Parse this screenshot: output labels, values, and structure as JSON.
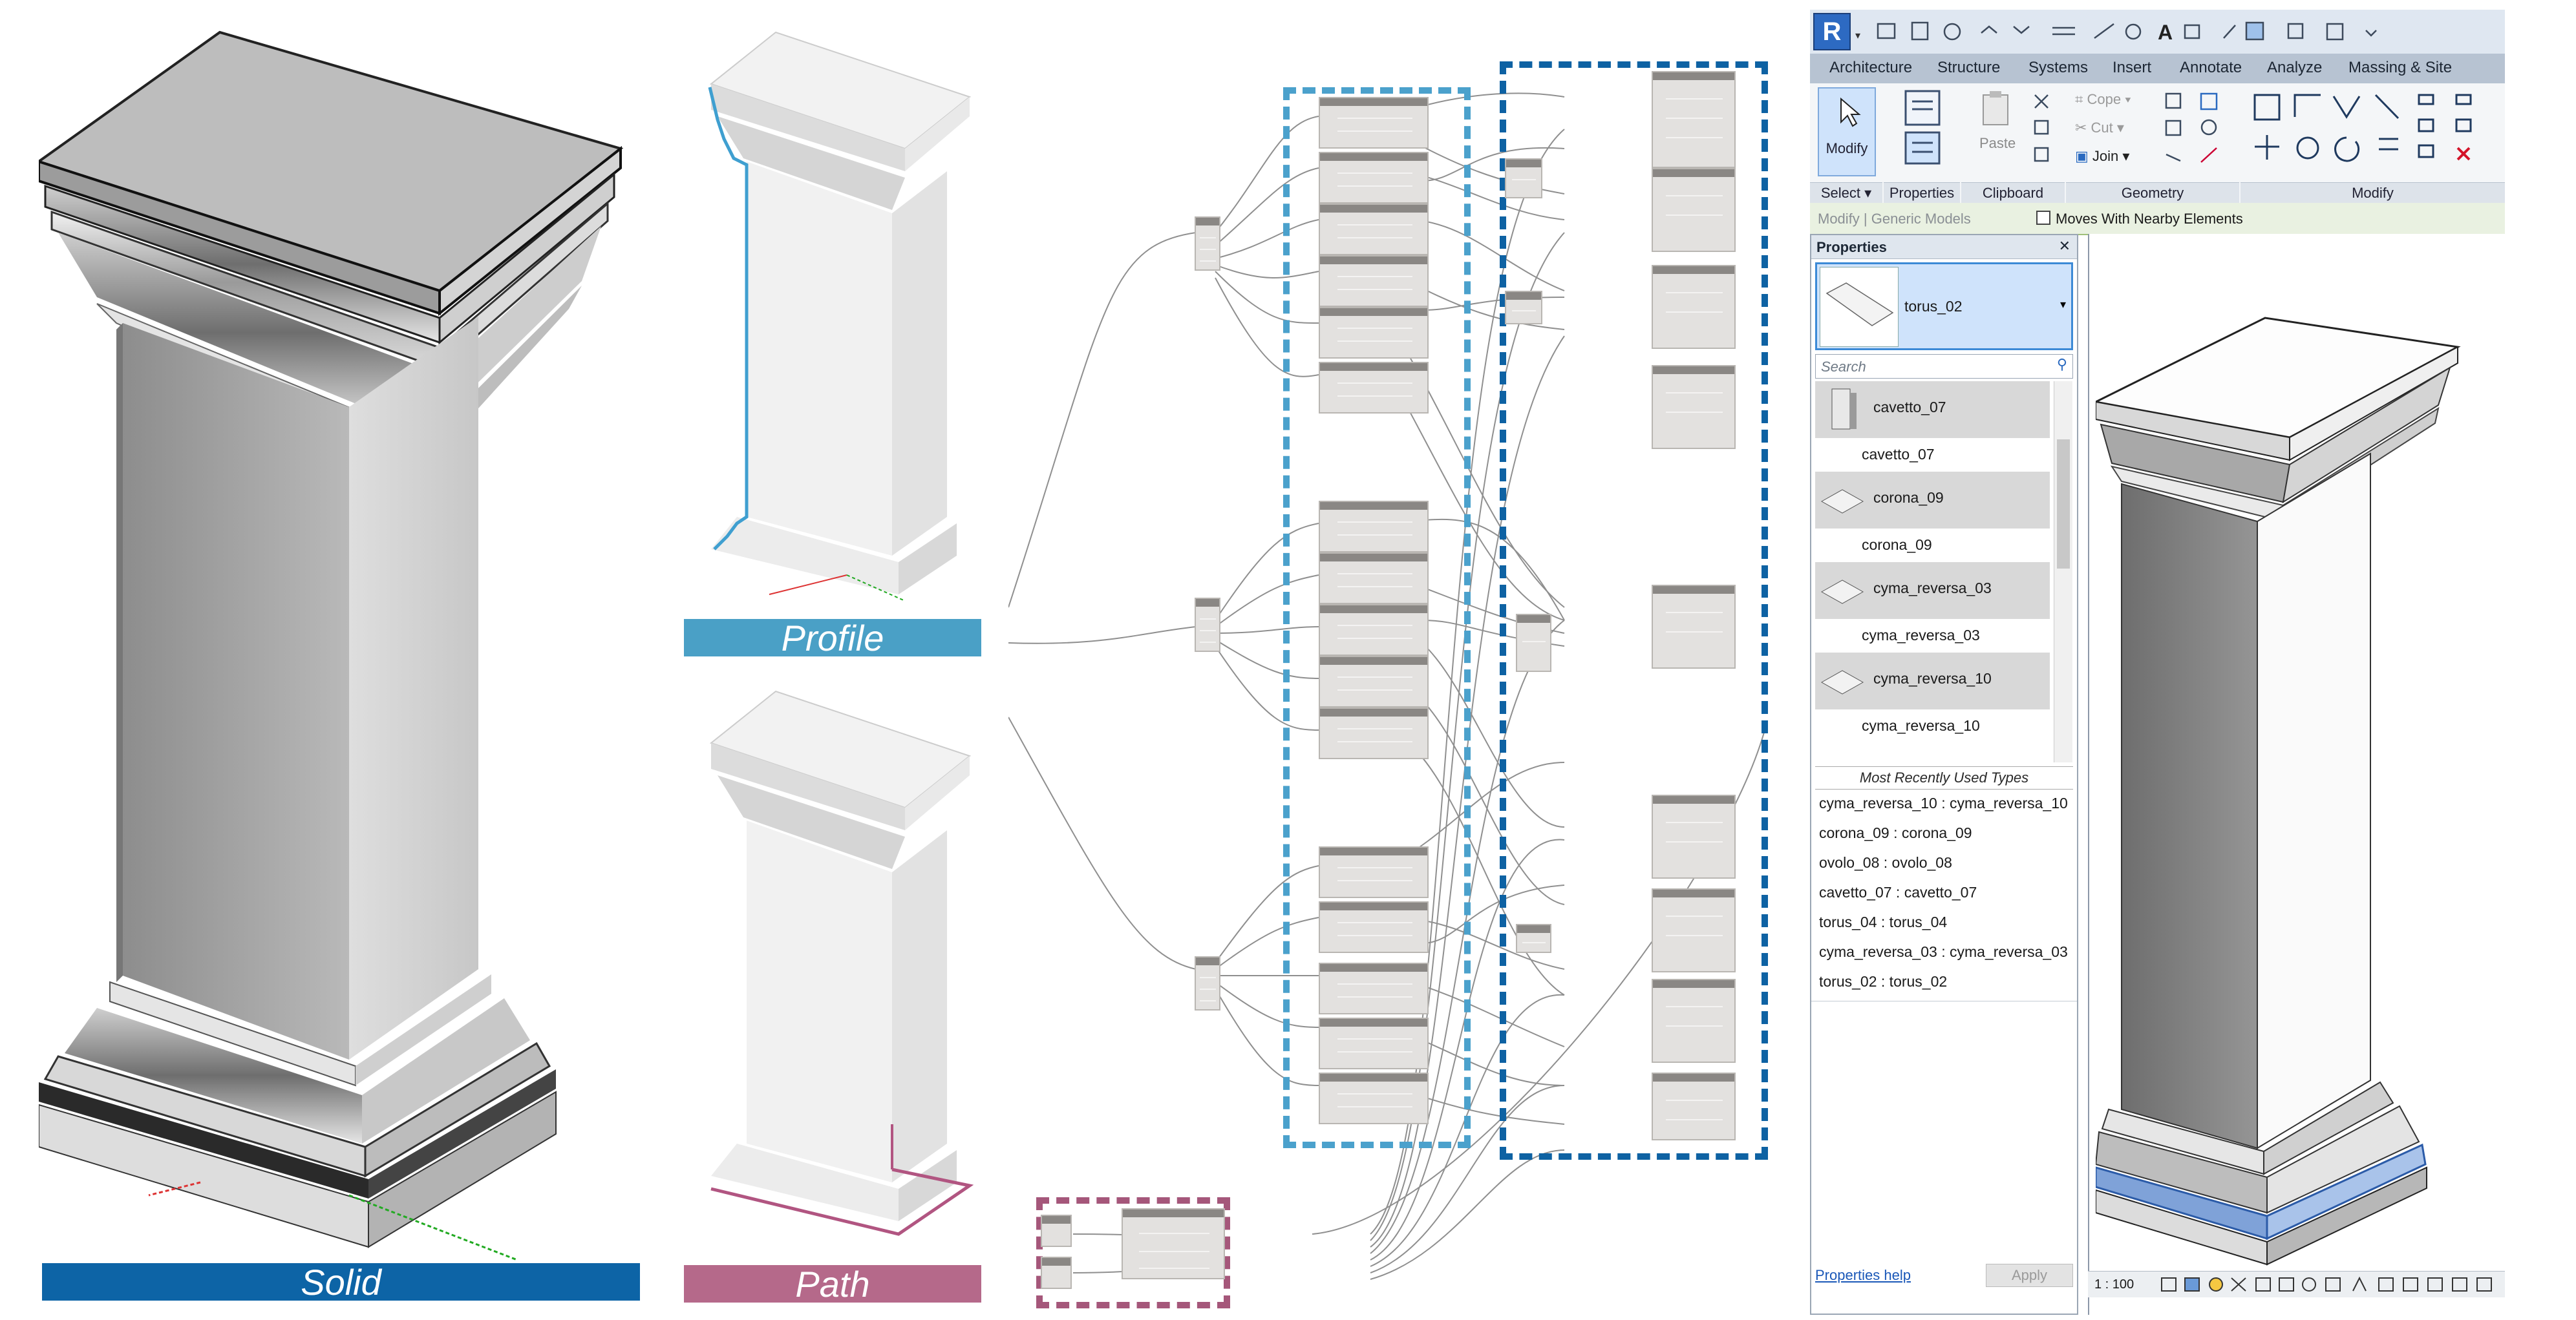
{
  "captions": {
    "solid": "Solid",
    "profile": "Profile",
    "path": "Path"
  },
  "colors": {
    "solid_bar": "#0d64a6",
    "profile_bar": "#4aa0c6",
    "path_bar": "#b5698a",
    "group_light_blue": "#4ba1cc",
    "group_dark_blue": "#0e62a3",
    "group_mauve": "#a5577a",
    "revit_highlight": "#cfe3fb",
    "context_green": "#e9f1e1"
  },
  "revit": {
    "app_button": "R",
    "ribbon_tabs": [
      "Architecture",
      "Structure",
      "Systems",
      "Insert",
      "Annotate",
      "Analyze",
      "Massing & Site"
    ],
    "tools": {
      "modify": "Modify",
      "paste": "Paste",
      "cope": "Cope",
      "cut": "Cut",
      "join": "Join"
    },
    "panels": {
      "select": "Select",
      "properties": "Properties",
      "clipboard": "Clipboard",
      "geometry": "Geometry",
      "modify": "Modify"
    },
    "context_bar": {
      "label": "Modify | Generic Models",
      "checkbox_label": "Moves With Nearby Elements"
    },
    "properties_palette": {
      "title": "Properties",
      "close": "✕",
      "selected_type": "torus_02",
      "search_placeholder": "Search",
      "type_list": [
        {
          "name": "cavetto_07",
          "sub": "cavetto_07"
        },
        {
          "name": "corona_09",
          "sub": "corona_09"
        },
        {
          "name": "cyma_reversa_03",
          "sub": "cyma_reversa_03"
        },
        {
          "name": "cyma_reversa_10",
          "sub": "cyma_reversa_10"
        }
      ],
      "mru_header": "Most Recently Used Types",
      "mru": [
        "cyma_reversa_10 : cyma_reversa_10",
        "corona_09 : corona_09",
        "ovolo_08 : ovolo_08",
        "cavetto_07 : cavetto_07",
        "torus_04 : torus_04",
        "cyma_reversa_03 : cyma_reversa_03",
        "torus_02 : torus_02"
      ],
      "help_link": "Properties help",
      "apply": "Apply"
    },
    "status": {
      "scale": "1 : 100"
    }
  }
}
